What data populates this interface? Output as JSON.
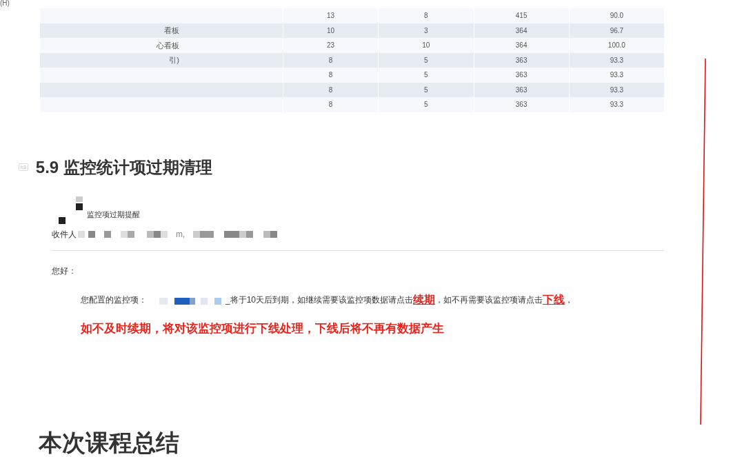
{
  "corner_text": "(H)",
  "table": {
    "rows": [
      {
        "label": "",
        "values": [
          "13",
          "8",
          "415",
          "90.0"
        ]
      },
      {
        "label": "看板",
        "values": [
          "10",
          "3",
          "364",
          "96.7"
        ]
      },
      {
        "label": "心看板",
        "values": [
          "23",
          "10",
          "364",
          "100.0"
        ]
      },
      {
        "label": "引)",
        "values": [
          "8",
          "5",
          "363",
          "93.3"
        ]
      },
      {
        "label": "",
        "values": [
          "8",
          "5",
          "363",
          "93.3"
        ]
      },
      {
        "label": "",
        "values": [
          "8",
          "5",
          "363",
          "93.3"
        ]
      },
      {
        "label": "",
        "values": [
          "8",
          "5",
          "363",
          "93.3"
        ]
      }
    ]
  },
  "heading": {
    "badge": "h3",
    "text": "5.9 监控统计项过期清理"
  },
  "email": {
    "subject": "监控项过期提醒",
    "recipients_label": "收件人",
    "recipients_fragment": "m,",
    "greeting": "您好：",
    "body": [
      {
        "kind": "text",
        "text": "您配置的监控项："
      },
      {
        "kind": "hidden"
      },
      {
        "kind": "text",
        "text": "_将于10天后到期，如继续需要该监控项数据请点击"
      },
      {
        "kind": "link",
        "text": "续期"
      },
      {
        "kind": "text",
        "text": "，如不再需要该监控项请点击"
      },
      {
        "kind": "link",
        "text": "下线"
      },
      {
        "kind": "text",
        "text": "，"
      }
    ],
    "warning": "如不及时续期，将对该监控项进行下线处理，下线后将不再有数据产生"
  },
  "next_heading": "本次课程总结"
}
